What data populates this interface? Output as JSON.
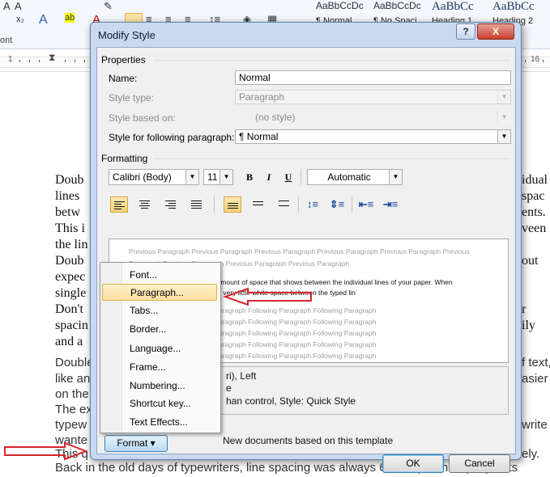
{
  "ribbon": {
    "styles": [
      {
        "sample": "AaBbCcDc",
        "name": "¶ Normal"
      },
      {
        "sample": "AaBbCcDc",
        "name": "¶ No Spaci..."
      },
      {
        "sample": "AaBbCc",
        "name": "Heading 1"
      },
      {
        "sample": "AaBbCc",
        "name": "Heading 2"
      }
    ],
    "font_fragment": "ont"
  },
  "ruler": {
    "left_mark": "1",
    "right_mark": "16"
  },
  "document": {
    "paragraphs_left": [
      "Doub",
      "lines",
      "betw",
      "This i",
      "the lin",
      "Doub",
      "expec",
      "single",
      "Don't",
      "spacin",
      "and a"
    ],
    "paragraphs_left2": [
      "Double",
      "like an",
      "on the",
      "The ex",
      "typew",
      "wante",
      "This q"
    ],
    "right_fragments": [
      "idual",
      "spac",
      "ents.",
      "veen",
      "out",
      "r",
      "ily",
      "f text,",
      "asier",
      "write",
      "ely."
    ],
    "last_line": "Back in the old days of typewriters, line spacing was always 6 lines per inch (12 points"
  },
  "dialog": {
    "title": "Modify Style",
    "help_label": "?",
    "close_label": "X",
    "properties_label": "Properties",
    "name_label": "Name:",
    "name_value": "Normal",
    "style_type_label": "Style type:",
    "style_type_value": "Paragraph",
    "style_based_label": "Style based on:",
    "style_based_value": "(no style)",
    "style_following_label": "Style for following paragraph:",
    "style_following_value": "¶ Normal",
    "formatting_label": "Formatting",
    "font_value": "Calibri (Body)",
    "size_value": "11",
    "bold": "B",
    "italic": "I",
    "underline": "U",
    "color_value": "Automatic",
    "preview_prev": [
      "Previous Paragraph Previous Paragraph Previous Paragraph Previous Paragraph Previous Paragraph Previous",
      "Paragraph Previous Paragraph Previous Paragraph Previous Paragraph"
    ],
    "preview_current": [
      "Double spacing refers to the amount of space that shows between the individual lines of your paper. When",
      "re is very little white space between the typed lin"
    ],
    "preview_following": [
      "g Paragraph Following Paragraph Following Paragraph",
      "g Paragraph Following Paragraph Following Paragraph",
      "g Paragraph Following Paragraph Following Paragraph",
      "g Paragraph Following Paragraph Following Paragraph",
      "g Paragraph Following Paragraph Following Paragraph"
    ],
    "description": [
      "ri), Left",
      "e",
      "han control, Style: Quick Style"
    ],
    "new_docs_label": "New documents based on this template",
    "format_label": "Format ▾",
    "ok_label": "OK",
    "cancel_label": "Cancel"
  },
  "menu": {
    "items": [
      {
        "label": "Font..."
      },
      {
        "label": "Paragraph..."
      },
      {
        "label": "Tabs..."
      },
      {
        "label": "Border..."
      },
      {
        "label": "Language..."
      },
      {
        "label": "Frame..."
      },
      {
        "label": "Numbering..."
      },
      {
        "label": "Shortcut key..."
      },
      {
        "label": "Text Effects..."
      }
    ],
    "highlighted_index": 1
  },
  "colors": {
    "arrow": "#d9252b",
    "highlight": "#fbe1a3",
    "dialog_frame": "#c9daf0"
  },
  "icons": [
    "help-icon",
    "close-icon",
    "dropdown-arrow-icon",
    "align-left-icon",
    "align-center-icon",
    "align-right-icon",
    "justify-icon",
    "line-spacing-icon",
    "indent-icon",
    "red-arrow-annotation"
  ]
}
